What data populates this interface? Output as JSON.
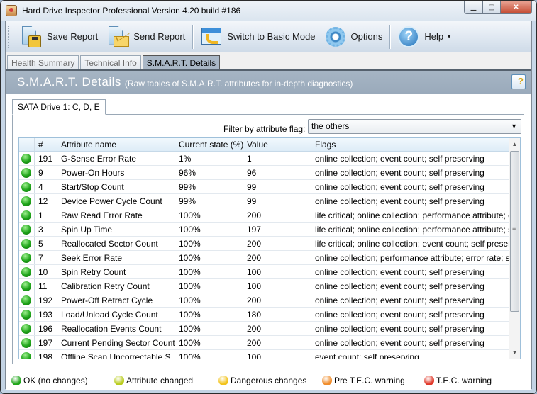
{
  "window": {
    "title": "Hard Drive Inspector Professional Version 4.20 build #186",
    "controls": {
      "minimize": "minimize",
      "maximize": "maximize",
      "close": "close"
    }
  },
  "toolbar": {
    "save_report": "Save Report",
    "send_report": "Send Report",
    "switch_basic": "Switch to Basic Mode",
    "options": "Options",
    "help": "Help"
  },
  "tabs": [
    {
      "label": "Health Summary",
      "active": false
    },
    {
      "label": "Technical Info",
      "active": false
    },
    {
      "label": "S.M.A.R.T. Details",
      "active": true
    }
  ],
  "header": {
    "title": "S.M.A.R.T. Details",
    "subtitle": "(Raw tables of S.M.A.R.T. attributes for in-depth diagnostics)"
  },
  "drive_tab": "SATA Drive 1: C, D, E",
  "filter": {
    "label": "Filter by attribute flag:",
    "selected": "the others"
  },
  "table": {
    "columns": [
      "",
      "#",
      "Attribute name",
      "Current state (%)",
      "Value",
      "Flags"
    ],
    "rows": [
      {
        "status": "ok",
        "id": "191",
        "name": "G-Sense Error Rate",
        "state": "1%",
        "value": "1",
        "flags": "online collection; event count; self preserving"
      },
      {
        "status": "ok",
        "id": "9",
        "name": "Power-On Hours",
        "state": "96%",
        "value": "96",
        "flags": "online collection; event count; self preserving"
      },
      {
        "status": "ok",
        "id": "4",
        "name": "Start/Stop Count",
        "state": "99%",
        "value": "99",
        "flags": "online collection; event count; self preserving"
      },
      {
        "status": "ok",
        "id": "12",
        "name": "Device Power Cycle Count",
        "state": "99%",
        "value": "99",
        "flags": "online collection; event count; self preserving"
      },
      {
        "status": "ok",
        "id": "1",
        "name": "Raw Read Error Rate",
        "state": "100%",
        "value": "200",
        "flags": "life critical; online collection; performance attribute; error ..."
      },
      {
        "status": "ok",
        "id": "3",
        "name": "Spin Up Time",
        "state": "100%",
        "value": "197",
        "flags": "life critical; online collection; performance attribute; self p..."
      },
      {
        "status": "ok",
        "id": "5",
        "name": "Reallocated Sector Count",
        "state": "100%",
        "value": "200",
        "flags": "life critical; online collection; event count; self preserving"
      },
      {
        "status": "ok",
        "id": "7",
        "name": "Seek Error Rate",
        "state": "100%",
        "value": "200",
        "flags": "online collection; performance attribute; error rate; self pr..."
      },
      {
        "status": "ok",
        "id": "10",
        "name": "Spin Retry Count",
        "state": "100%",
        "value": "100",
        "flags": "online collection; event count; self preserving"
      },
      {
        "status": "ok",
        "id": "11",
        "name": "Calibration Retry Count",
        "state": "100%",
        "value": "100",
        "flags": "online collection; event count; self preserving"
      },
      {
        "status": "ok",
        "id": "192",
        "name": "Power-Off Retract Cycle",
        "state": "100%",
        "value": "200",
        "flags": "online collection; event count; self preserving"
      },
      {
        "status": "ok",
        "id": "193",
        "name": "Load/Unload Cycle Count",
        "state": "100%",
        "value": "180",
        "flags": "online collection; event count; self preserving"
      },
      {
        "status": "ok",
        "id": "196",
        "name": "Reallocation Events Count",
        "state": "100%",
        "value": "200",
        "flags": "online collection; event count; self preserving"
      },
      {
        "status": "ok",
        "id": "197",
        "name": "Current Pending Sector Count",
        "state": "100%",
        "value": "200",
        "flags": "online collection; event count; self preserving"
      },
      {
        "status": "ok",
        "id": "198",
        "name": "Offline Scan Uncorrectable S...",
        "state": "100%",
        "value": "100",
        "flags": "event count; self preserving"
      }
    ]
  },
  "legend": [
    {
      "label": "OK (no changes)",
      "color": "#1fa51a"
    },
    {
      "label": "Attribute changed",
      "color": "#b9cc1e"
    },
    {
      "label": "Dangerous changes",
      "color": "#f2c31b"
    },
    {
      "label": "Pre T.E.C. warning",
      "color": "#f08c2a"
    },
    {
      "label": "T.E.C. warning",
      "color": "#e0392a"
    }
  ]
}
